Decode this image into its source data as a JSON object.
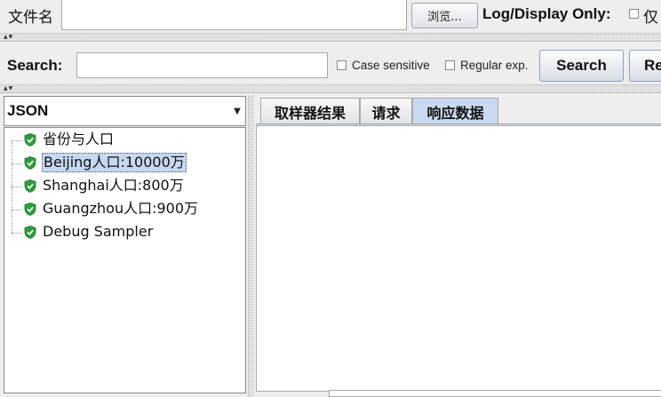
{
  "file_row": {
    "label": "文件名",
    "value": "",
    "browse_label": "浏览...",
    "log_display_label": "Log/Display Only:",
    "only_label": "仅"
  },
  "search_row": {
    "label": "Search:",
    "value": "",
    "case_sensitive_label": "Case sensitive",
    "regex_label": "Regular exp.",
    "search_button": "Search",
    "reset_button": "Re"
  },
  "renderer": {
    "selected": "JSON"
  },
  "tree": {
    "items": [
      {
        "label": "省份与人口",
        "icon": "green-shield-check-icon",
        "selected": false
      },
      {
        "label": "Beijing人口:10000万",
        "icon": "green-shield-check-icon",
        "selected": true
      },
      {
        "label": "Shanghai人口:800万",
        "icon": "green-shield-check-icon",
        "selected": false
      },
      {
        "label": "Guangzhou人口:900万",
        "icon": "green-shield-check-icon",
        "selected": false
      },
      {
        "label": "Debug Sampler",
        "icon": "green-shield-check-icon",
        "selected": false
      }
    ]
  },
  "tabs": [
    {
      "label": "取样器结果",
      "active": false
    },
    {
      "label": "请求",
      "active": false
    },
    {
      "label": "响应数据",
      "active": true
    }
  ],
  "colors": {
    "selection": "#c6d8f0",
    "active_tab": "#c9daf0",
    "shield_green": "#2e9e3a"
  }
}
